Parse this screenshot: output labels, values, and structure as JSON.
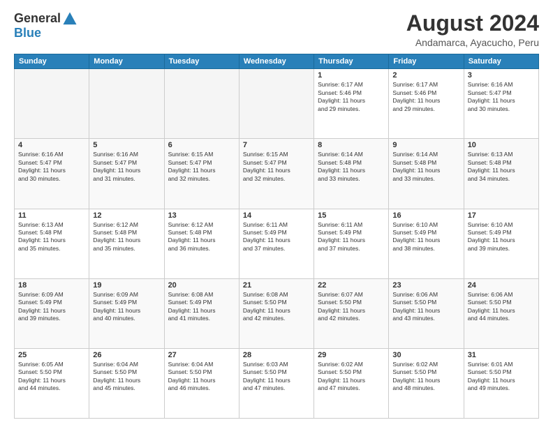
{
  "header": {
    "logo_general": "General",
    "logo_blue": "Blue",
    "month_year": "August 2024",
    "location": "Andamarca, Ayacucho, Peru"
  },
  "days_of_week": [
    "Sunday",
    "Monday",
    "Tuesday",
    "Wednesday",
    "Thursday",
    "Friday",
    "Saturday"
  ],
  "weeks": [
    [
      {
        "day": "",
        "info": ""
      },
      {
        "day": "",
        "info": ""
      },
      {
        "day": "",
        "info": ""
      },
      {
        "day": "",
        "info": ""
      },
      {
        "day": "1",
        "info": "Sunrise: 6:17 AM\nSunset: 5:46 PM\nDaylight: 11 hours\nand 29 minutes."
      },
      {
        "day": "2",
        "info": "Sunrise: 6:17 AM\nSunset: 5:46 PM\nDaylight: 11 hours\nand 29 minutes."
      },
      {
        "day": "3",
        "info": "Sunrise: 6:16 AM\nSunset: 5:47 PM\nDaylight: 11 hours\nand 30 minutes."
      }
    ],
    [
      {
        "day": "4",
        "info": "Sunrise: 6:16 AM\nSunset: 5:47 PM\nDaylight: 11 hours\nand 30 minutes."
      },
      {
        "day": "5",
        "info": "Sunrise: 6:16 AM\nSunset: 5:47 PM\nDaylight: 11 hours\nand 31 minutes."
      },
      {
        "day": "6",
        "info": "Sunrise: 6:15 AM\nSunset: 5:47 PM\nDaylight: 11 hours\nand 32 minutes."
      },
      {
        "day": "7",
        "info": "Sunrise: 6:15 AM\nSunset: 5:47 PM\nDaylight: 11 hours\nand 32 minutes."
      },
      {
        "day": "8",
        "info": "Sunrise: 6:14 AM\nSunset: 5:48 PM\nDaylight: 11 hours\nand 33 minutes."
      },
      {
        "day": "9",
        "info": "Sunrise: 6:14 AM\nSunset: 5:48 PM\nDaylight: 11 hours\nand 33 minutes."
      },
      {
        "day": "10",
        "info": "Sunrise: 6:13 AM\nSunset: 5:48 PM\nDaylight: 11 hours\nand 34 minutes."
      }
    ],
    [
      {
        "day": "11",
        "info": "Sunrise: 6:13 AM\nSunset: 5:48 PM\nDaylight: 11 hours\nand 35 minutes."
      },
      {
        "day": "12",
        "info": "Sunrise: 6:12 AM\nSunset: 5:48 PM\nDaylight: 11 hours\nand 35 minutes."
      },
      {
        "day": "13",
        "info": "Sunrise: 6:12 AM\nSunset: 5:48 PM\nDaylight: 11 hours\nand 36 minutes."
      },
      {
        "day": "14",
        "info": "Sunrise: 6:11 AM\nSunset: 5:49 PM\nDaylight: 11 hours\nand 37 minutes."
      },
      {
        "day": "15",
        "info": "Sunrise: 6:11 AM\nSunset: 5:49 PM\nDaylight: 11 hours\nand 37 minutes."
      },
      {
        "day": "16",
        "info": "Sunrise: 6:10 AM\nSunset: 5:49 PM\nDaylight: 11 hours\nand 38 minutes."
      },
      {
        "day": "17",
        "info": "Sunrise: 6:10 AM\nSunset: 5:49 PM\nDaylight: 11 hours\nand 39 minutes."
      }
    ],
    [
      {
        "day": "18",
        "info": "Sunrise: 6:09 AM\nSunset: 5:49 PM\nDaylight: 11 hours\nand 39 minutes."
      },
      {
        "day": "19",
        "info": "Sunrise: 6:09 AM\nSunset: 5:49 PM\nDaylight: 11 hours\nand 40 minutes."
      },
      {
        "day": "20",
        "info": "Sunrise: 6:08 AM\nSunset: 5:49 PM\nDaylight: 11 hours\nand 41 minutes."
      },
      {
        "day": "21",
        "info": "Sunrise: 6:08 AM\nSunset: 5:50 PM\nDaylight: 11 hours\nand 42 minutes."
      },
      {
        "day": "22",
        "info": "Sunrise: 6:07 AM\nSunset: 5:50 PM\nDaylight: 11 hours\nand 42 minutes."
      },
      {
        "day": "23",
        "info": "Sunrise: 6:06 AM\nSunset: 5:50 PM\nDaylight: 11 hours\nand 43 minutes."
      },
      {
        "day": "24",
        "info": "Sunrise: 6:06 AM\nSunset: 5:50 PM\nDaylight: 11 hours\nand 44 minutes."
      }
    ],
    [
      {
        "day": "25",
        "info": "Sunrise: 6:05 AM\nSunset: 5:50 PM\nDaylight: 11 hours\nand 44 minutes."
      },
      {
        "day": "26",
        "info": "Sunrise: 6:04 AM\nSunset: 5:50 PM\nDaylight: 11 hours\nand 45 minutes."
      },
      {
        "day": "27",
        "info": "Sunrise: 6:04 AM\nSunset: 5:50 PM\nDaylight: 11 hours\nand 46 minutes."
      },
      {
        "day": "28",
        "info": "Sunrise: 6:03 AM\nSunset: 5:50 PM\nDaylight: 11 hours\nand 47 minutes."
      },
      {
        "day": "29",
        "info": "Sunrise: 6:02 AM\nSunset: 5:50 PM\nDaylight: 11 hours\nand 47 minutes."
      },
      {
        "day": "30",
        "info": "Sunrise: 6:02 AM\nSunset: 5:50 PM\nDaylight: 11 hours\nand 48 minutes."
      },
      {
        "day": "31",
        "info": "Sunrise: 6:01 AM\nSunset: 5:50 PM\nDaylight: 11 hours\nand 49 minutes."
      }
    ]
  ]
}
